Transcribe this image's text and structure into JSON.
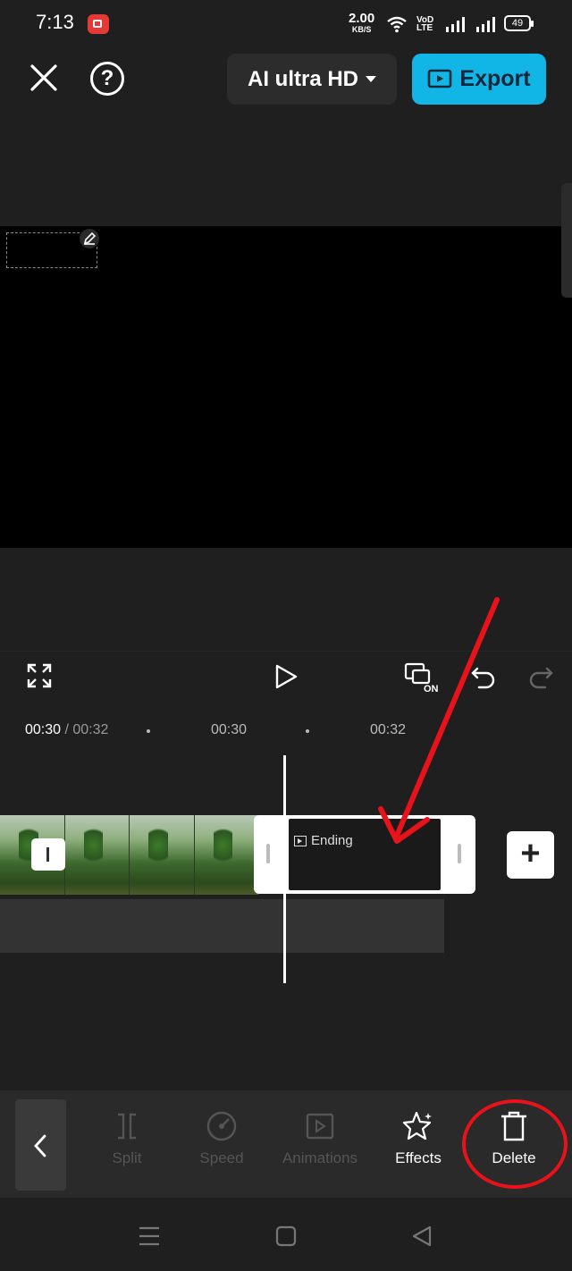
{
  "status_bar": {
    "time": "7:13",
    "net_speed_value": "2.00",
    "net_speed_unit": "KB/S",
    "volte": "VoD LTE",
    "battery": "49"
  },
  "top_bar": {
    "quality_label": "AI ultra HD",
    "export_label": "Export"
  },
  "timeline": {
    "current_time": "00:30",
    "total_time": " / 00:32",
    "marks": [
      "00:30",
      "00:32"
    ],
    "ending_label": "Ending"
  },
  "toolbar": {
    "items": [
      {
        "label": "Split",
        "icon": "split-icon",
        "enabled": false
      },
      {
        "label": "Speed",
        "icon": "speed-icon",
        "enabled": false
      },
      {
        "label": "Animations",
        "icon": "animations-icon",
        "enabled": false
      },
      {
        "label": "Effects",
        "icon": "effects-icon",
        "enabled": true
      },
      {
        "label": "Delete",
        "icon": "delete-icon",
        "enabled": true
      }
    ]
  },
  "colors": {
    "export": "#12b6e6",
    "annotation": "#e8121b",
    "background": "#1f1f1f"
  }
}
